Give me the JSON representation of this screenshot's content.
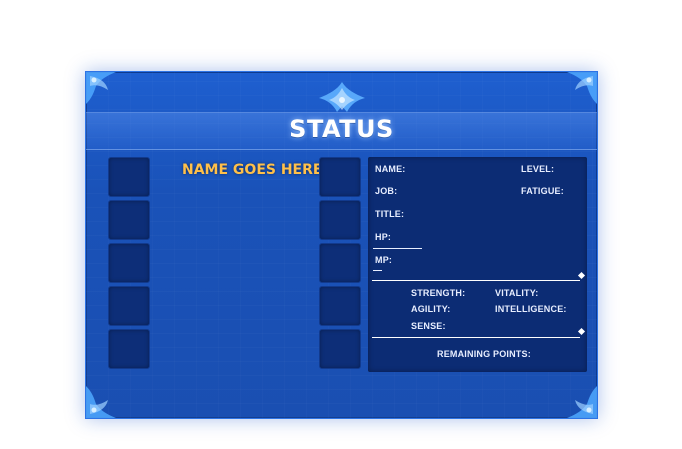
{
  "title": "STATUS",
  "name_placeholder": "NAME GOES HERE...",
  "info": {
    "name_label": "NAME:",
    "level_label": "LEVEL:",
    "job_label": "JOB:",
    "fatigue_label": "FATIGUE:",
    "title_label": "TITLE:",
    "hp_label": "HP:",
    "mp_label": "MP:"
  },
  "attributes": {
    "strength_label": "STRENGTH:",
    "vitality_label": "VITALITY:",
    "agility_label": "AGILITY:",
    "intelligence_label": "INTELLIGENCE:",
    "sense_label": "SENSE:"
  },
  "remaining_points_label": "REMAINING POINTS:",
  "colors": {
    "panel_blue": "#1a52b8",
    "slot_navy": "#0d2e78",
    "name_gold": "#ffc04a",
    "text_white": "#e8eeff"
  }
}
